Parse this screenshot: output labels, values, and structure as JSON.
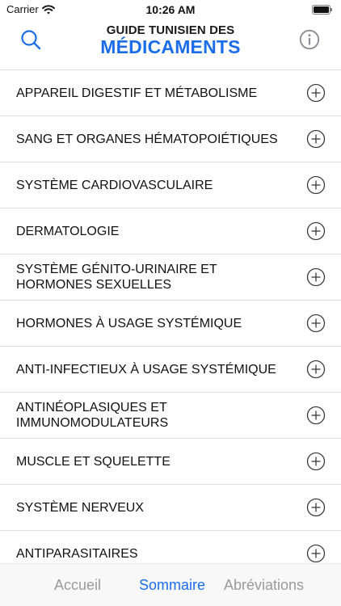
{
  "status_bar": {
    "carrier": "Carrier",
    "time": "10:26 AM"
  },
  "header": {
    "title_top": "GUIDE TUNISIEN DES",
    "title_main": "MÉDICAMENTS",
    "accent_color": "#1c6ee8",
    "left_icon": "search-icon",
    "right_icon": "info-icon"
  },
  "categories": [
    {
      "label": "APPAREIL DIGESTIF ET MÉTABOLISME",
      "icon": "plus-circle-icon"
    },
    {
      "label": "SANG ET ORGANES HÉMATOPOIÉTIQUES",
      "icon": "plus-circle-icon"
    },
    {
      "label": "SYSTÈME CARDIOVASCULAIRE",
      "icon": "plus-circle-icon"
    },
    {
      "label": "DERMATOLOGIE",
      "icon": "plus-circle-icon"
    },
    {
      "label": "SYSTÈME GÉNITO-URINAIRE ET HORMONES SEXUELLES",
      "icon": "plus-circle-icon"
    },
    {
      "label": "HORMONES À USAGE SYSTÉMIQUE",
      "icon": "plus-circle-icon"
    },
    {
      "label": "ANTI-INFECTIEUX À USAGE SYSTÉMIQUE",
      "icon": "plus-circle-icon"
    },
    {
      "label": "ANTINÉOPLASIQUES ET IMMUNOMODULATEURS",
      "icon": "plus-circle-icon"
    },
    {
      "label": "MUSCLE ET SQUELETTE",
      "icon": "plus-circle-icon"
    },
    {
      "label": "SYSTÈME NERVEUX",
      "icon": "plus-circle-icon"
    },
    {
      "label": "ANTIPARASITAIRES",
      "icon": "plus-circle-icon"
    }
  ],
  "tabs": {
    "accueil": "Accueil",
    "sommaire": "Sommaire",
    "abreviations": "Abréviations",
    "active": "sommaire"
  }
}
